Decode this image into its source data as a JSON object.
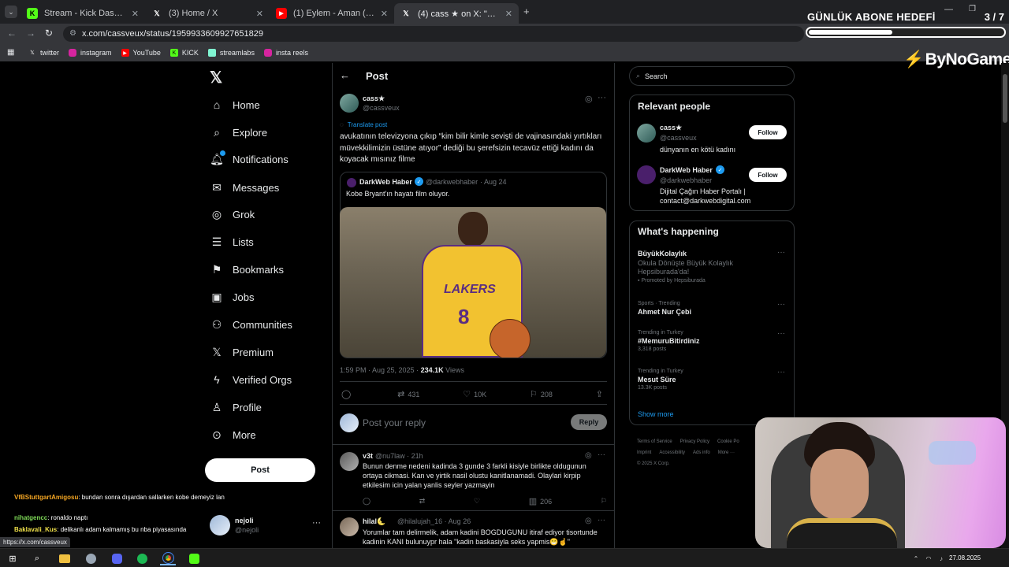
{
  "browser": {
    "tabs": [
      {
        "label": "Stream - Kick Dashboard",
        "favicon": "kick-icon",
        "active": false
      },
      {
        "label": "(3) Home / X",
        "favicon": "x-icon",
        "active": false
      },
      {
        "label": "(1) Eylem - Aman (Official Video)",
        "favicon": "youtube-icon",
        "active": false
      },
      {
        "label": "(4) cass ★ on X: \"avukatının tele",
        "favicon": "x-icon",
        "active": true
      }
    ],
    "url": "x.com/cassveux/status/1959933609927651829",
    "bookmarks": [
      "twitter",
      "instagram",
      "YouTube",
      "KICK",
      "streamlabs",
      "insta reels"
    ],
    "status_url": "https://x.com/cassveux"
  },
  "overlay": {
    "goal_title": "GÜNLÜK ABONE HEDEFİ",
    "goal_count": "3 / 7",
    "goal_progress": 0.43,
    "brand": "ByNoGame"
  },
  "nav": {
    "items": [
      "Home",
      "Explore",
      "Notifications",
      "Messages",
      "Grok",
      "Lists",
      "Bookmarks",
      "Jobs",
      "Communities",
      "Premium",
      "Verified Orgs",
      "Profile",
      "More"
    ],
    "post_label": "Post",
    "account": {
      "name": "nejoli",
      "handle": "@nejoli"
    }
  },
  "main": {
    "header_title": "Post",
    "author": {
      "name": "cass★",
      "handle": "@cassveux"
    },
    "translate": "Translate post",
    "text": "avukatının televizyona çıkıp “kim bilir kimle sevişti de vajinasındaki yırtıkları müvekkilimizin üstüne atıyor” dediği bu şerefsizin tecavüz ettiği kadını da koyacak mısınız filme",
    "quote": {
      "name": "DarkWeb Haber",
      "handle": "@darkwebhaber",
      "date": "· Aug 24",
      "text": "Kobe Bryant'ın hayatı film oluyor.",
      "jersey": "LAKERS",
      "number": "8"
    },
    "time": "1:59 PM · Aug 25, 2025 ·",
    "views_count": "234.1K",
    "views_label": "Views",
    "stats": {
      "replies": "",
      "reposts": "431",
      "likes": "10K",
      "bookmarks": "208"
    },
    "reply_placeholder": "Post your reply",
    "reply_button": "Reply",
    "replies": [
      {
        "name": "v3t",
        "handle": "@nu7law · 21h",
        "text": "Bunun denme nedeni kadinda 3 gunde 3 farkli kisiyle birlikte oldugunun ortaya cikmasi. Kan ve yirtik nasil olustu kanitlanamadi. Olaylari kirpip etkilesim icin yalan yanlis seyler yazmayin",
        "views": "206"
      },
      {
        "name": "hilal🌜",
        "handle": "@hilalujah_16 · Aug 26",
        "text": "Yorumlar tam delirmelik, adam kadini BOGDUGUNU itiraf ediyor tisortunde kadinin KANI bulunuypr hala \"kadin baskasiyla seks yapmis😁☝️\""
      }
    ]
  },
  "right": {
    "search_placeholder": "Search",
    "relevant_title": "Relevant people",
    "people": [
      {
        "name": "cass★",
        "handle": "@cassveux",
        "bio": "dünyanın en kötü kadını",
        "follow": "Follow"
      },
      {
        "name": "DarkWeb Haber",
        "handle": "@darkwebhaber",
        "bio": "Dijital Çağın Haber Portalı | contact@darkwebdigital.com",
        "follow": "Follow"
      }
    ],
    "happening_title": "What's happening",
    "trends": [
      {
        "meta": "",
        "title": "BüyükKolaylık",
        "sub": "Okula Dönüşte Büyük Kolaylık Hepsiburada'da!",
        "extra": "Promoted by Hepsiburada"
      },
      {
        "meta": "Sports · Trending",
        "title": "Ahmet Nur Çebi",
        "sub": "",
        "extra": ""
      },
      {
        "meta": "Trending in Turkey",
        "title": "#MemuruBitirdiniz",
        "sub": "3,318 posts",
        "extra": ""
      },
      {
        "meta": "Trending in Turkey",
        "title": "Mesut Süre",
        "sub": "13.3K posts",
        "extra": ""
      }
    ],
    "show_more": "Show more",
    "footer": [
      "Terms of Service",
      "Privacy Policy",
      "Cookie Po",
      "Imprint",
      "Accessibility",
      "Ads info",
      "More ···",
      "© 2025 X Corp."
    ]
  },
  "chat": [
    {
      "user": "VfBStuttgartAmigosu",
      "color": "#f5a623",
      "msg": ": bundan sonra dışardan sallarken kobe demeyiz lan"
    },
    {
      "user": "nihatgencc",
      "color": "#7ed957",
      "msg": ": ronaldo naptı"
    },
    {
      "user": "Baklavali_Kus",
      "color": "#f0e14a",
      "msg": ": delikanlı adam kalmamış bu nba piyasasında"
    }
  ],
  "taskbar": {
    "date": "27.08.2025"
  }
}
